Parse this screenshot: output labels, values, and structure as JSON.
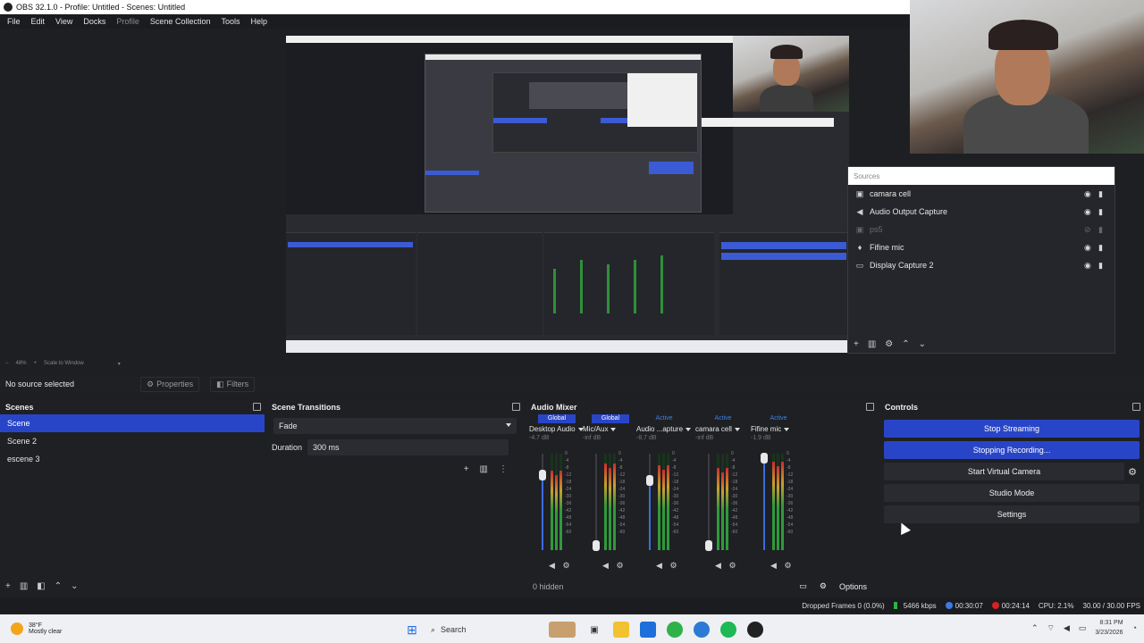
{
  "window": {
    "title": "OBS 32.1.0 - Profile: Untitled - Scenes: Untitled"
  },
  "menu": [
    "File",
    "Edit",
    "View",
    "Docks",
    "Profile",
    "Scene Collection",
    "Tools",
    "Help"
  ],
  "sources": {
    "header": "Sources",
    "items": [
      {
        "label": "camara cell",
        "icon": "camera-icon",
        "dim": false
      },
      {
        "label": "Audio Output Capture",
        "icon": "speaker-icon",
        "dim": false
      },
      {
        "label": "ps5",
        "icon": "camera-icon",
        "dim": true
      },
      {
        "label": "Fifine mic",
        "icon": "mic-icon",
        "dim": false
      },
      {
        "label": "Display Capture 2",
        "icon": "monitor-icon",
        "dim": false
      }
    ]
  },
  "preview_zoom": {
    "zoom": "48%",
    "mode": "Scale to Window"
  },
  "source_bar": {
    "selected": "No source selected",
    "properties": "Properties",
    "filters": "Filters"
  },
  "scenes": {
    "title": "Scenes",
    "items": [
      {
        "label": "Scene",
        "selected": true
      },
      {
        "label": "Scene 2",
        "selected": false
      },
      {
        "label": "escene 3",
        "selected": false
      }
    ]
  },
  "transitions": {
    "title": "Scene Transitions",
    "type": "Fade",
    "duration_label": "Duration",
    "duration_value": "300 ms"
  },
  "mixer": {
    "title": "Audio Mixer",
    "hidden": "0 hidden",
    "options": "Options",
    "channels": [
      {
        "tag": "Global",
        "name": "Desktop Audio",
        "db": "-4.7 dB",
        "level": 0.82,
        "fader": 0.78
      },
      {
        "tag": "Global",
        "name": "Mic/Aux",
        "db": "-inf dB",
        "level": 0.9,
        "fader": 0.05
      },
      {
        "tag": "Active",
        "name": "Audio ...apture",
        "db": "-8.7 dB",
        "level": 0.88,
        "fader": 0.72
      },
      {
        "tag": "Active",
        "name": "camara cell",
        "db": "-inf dB",
        "level": 0.85,
        "fader": 0.05
      },
      {
        "tag": "Active",
        "name": "Fifine mic",
        "db": "-1.9 dB",
        "level": 0.92,
        "fader": 0.95
      }
    ],
    "scale": [
      "0",
      "-4",
      "-8",
      "-12",
      "-18",
      "-24",
      "-30",
      "-36",
      "-42",
      "-48",
      "-54",
      "-60"
    ]
  },
  "controls": {
    "title": "Controls",
    "buttons": [
      {
        "label": "Stop Streaming",
        "active": true
      },
      {
        "label": "Stopping Recording...",
        "active": true
      },
      {
        "label": "Start Virtual Camera",
        "active": false
      },
      {
        "label": "Studio Mode",
        "active": false
      },
      {
        "label": "Settings",
        "active": false
      }
    ]
  },
  "status": {
    "dropped": "Dropped Frames 0 (0.0%)",
    "bitrate": "5466 kbps",
    "stream_time": "00:30:07",
    "rec_time": "00:24:14",
    "cpu": "CPU: 2.1%",
    "fps": "30.00 / 30.00 FPS"
  },
  "taskbar": {
    "temp": "38°F",
    "weather": "Mostly clear",
    "search": "Search",
    "time": "8:31 PM",
    "date": "3/23/2026"
  },
  "colors": {
    "accent": "#2945c7",
    "bg": "#1f2024",
    "meter_green": "#2f9a3a"
  }
}
